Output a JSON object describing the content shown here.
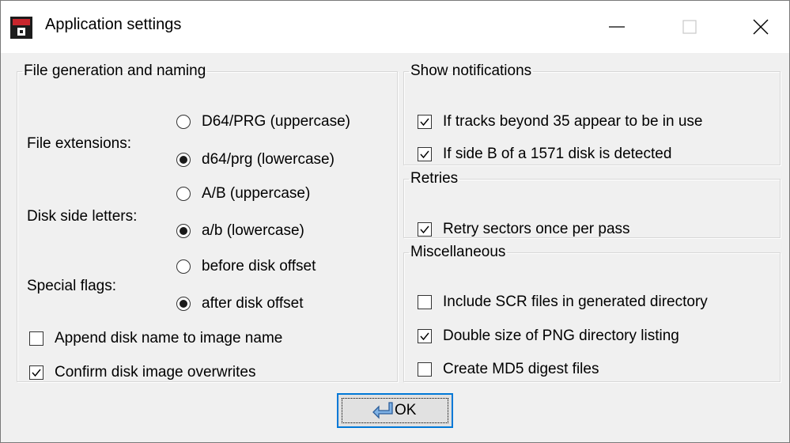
{
  "window": {
    "title": "Application settings",
    "minimize_icon": "minimize-icon",
    "maximize_icon": "maximize-icon",
    "close_icon": "close-icon"
  },
  "file_group": {
    "legend": "File generation and naming",
    "extensions": {
      "label": "File extensions:",
      "options": [
        {
          "label": "D64/PRG (uppercase)",
          "selected": false
        },
        {
          "label": "d64/prg (lowercase)",
          "selected": true
        }
      ]
    },
    "side_letters": {
      "label": "Disk side letters:",
      "options": [
        {
          "label": "A/B (uppercase)",
          "selected": false
        },
        {
          "label": "a/b (lowercase)",
          "selected": true
        }
      ]
    },
    "special_flags": {
      "label": "Special flags:",
      "options": [
        {
          "label": "before disk offset",
          "selected": false
        },
        {
          "label": "after disk offset",
          "selected": true
        }
      ]
    },
    "checkboxes": [
      {
        "label": "Append disk name to image name",
        "checked": false
      },
      {
        "label": "Confirm disk image overwrites",
        "checked": true
      }
    ]
  },
  "notifications_group": {
    "legend": "Show notifications",
    "checkboxes": [
      {
        "label": "If tracks beyond 35 appear to be in use",
        "checked": true
      },
      {
        "label": "If side B of a 1571 disk is detected",
        "checked": true
      }
    ]
  },
  "retries_group": {
    "legend": "Retries",
    "checkboxes": [
      {
        "label": "Retry sectors once per pass",
        "checked": true
      }
    ]
  },
  "misc_group": {
    "legend": "Miscellaneous",
    "checkboxes": [
      {
        "label": "Include SCR files in generated directory",
        "checked": false
      },
      {
        "label": "Double size of PNG directory listing",
        "checked": true
      },
      {
        "label": "Create MD5 digest files",
        "checked": false
      }
    ]
  },
  "ok_button": {
    "label": "OK",
    "icon": "return-arrow-icon"
  },
  "colors": {
    "accent": "#0078d7",
    "background": "#f0f0f0",
    "titlebar": "#ffffff"
  }
}
